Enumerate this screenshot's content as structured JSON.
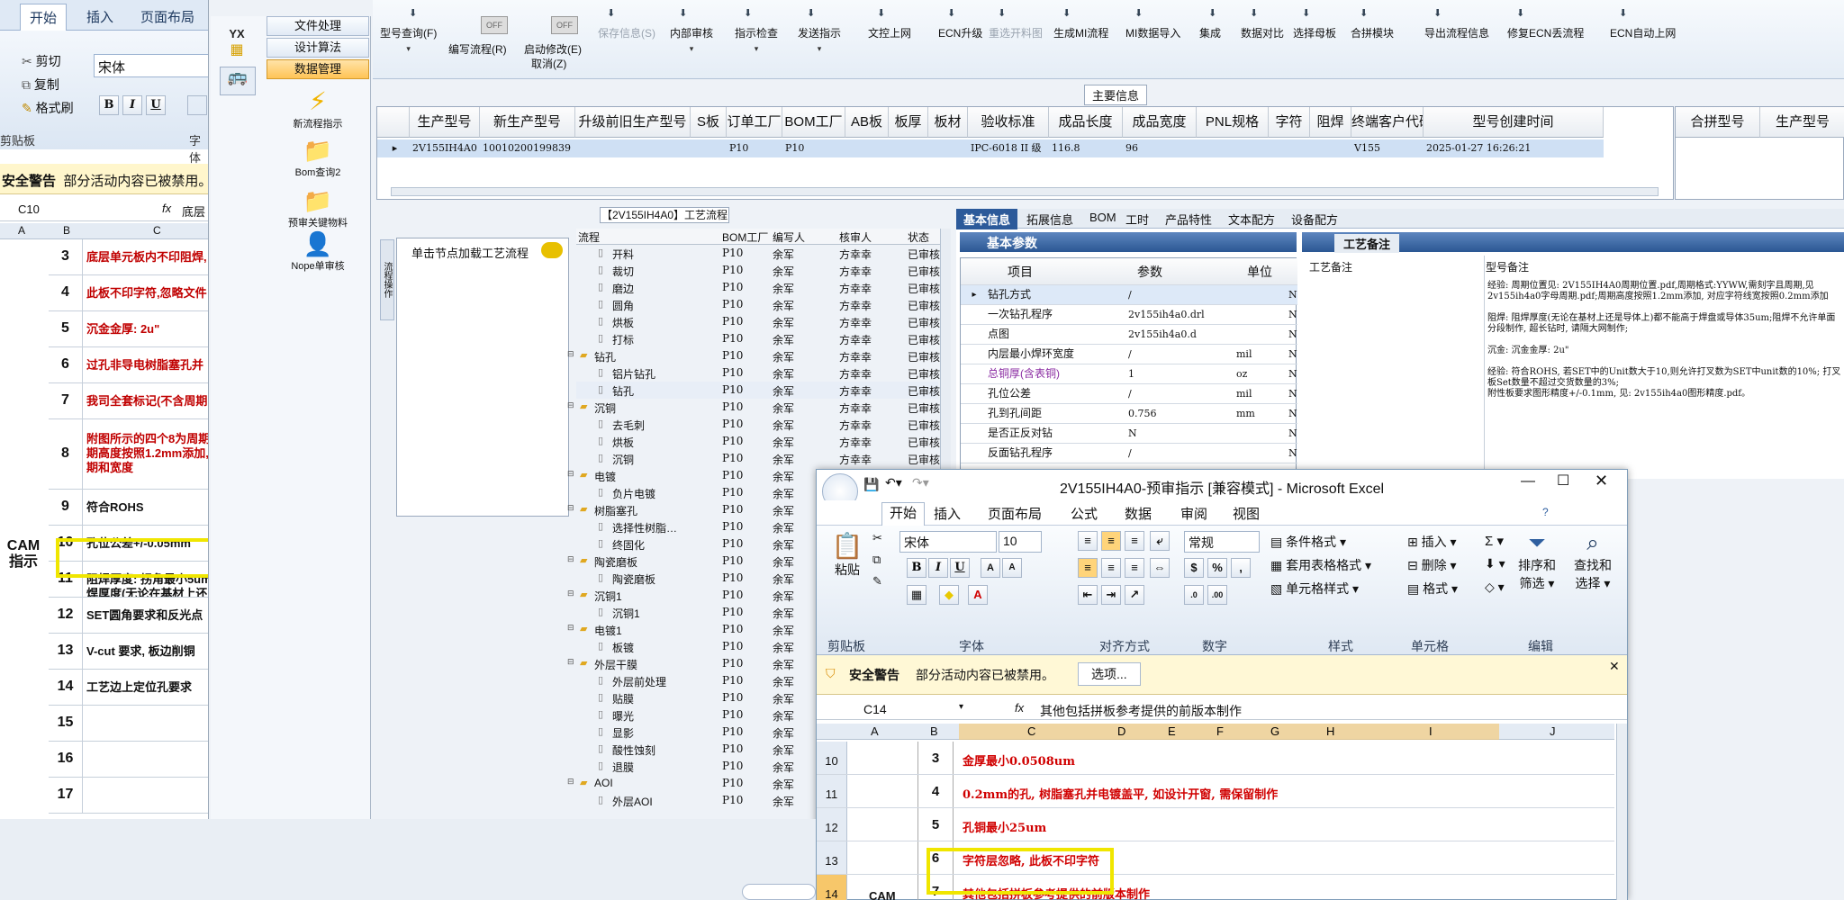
{
  "left_excel": {
    "tabs": [
      "开始",
      "插入",
      "页面布局"
    ],
    "clipboard": [
      "剪切",
      "复制",
      "格式刷"
    ],
    "font": "宋体",
    "group_clipboard": "剪贴板",
    "group_font": "字体",
    "security_warning": "安全警告",
    "security_msg": "部分活动内容已被禁用。",
    "cell_ref": "C10",
    "formula_partial": "底层",
    "col_headers": [
      "A",
      "B",
      "C"
    ],
    "side_label": "CAM 指示",
    "rows": [
      {
        "n": "3",
        "t": "底层单元板内不印阻焊,",
        "red": true
      },
      {
        "n": "4",
        "t": "此板不印字符,忽略文件",
        "red": true
      },
      {
        "n": "5",
        "t": "沉金金厚: 2u\"",
        "red": true
      },
      {
        "n": "6",
        "t": "过孔非导电树脂塞孔并",
        "red": true
      },
      {
        "n": "7",
        "t": "我司全套标记(不含周期",
        "red": true
      },
      {
        "n": "8",
        "t": "附图所示的四个8为周期\n期高度按照1.2mm添加,\n期和宽度",
        "red": true
      },
      {
        "n": "9",
        "t": "符合ROHS",
        "red": false
      },
      {
        "n": "10",
        "t": "孔位公差+/-0.05mm",
        "red": false
      },
      {
        "n": "11",
        "t": "阻焊厚度: 拐角最小5um\n焊厚度(无论在基材上还",
        "red": false
      },
      {
        "n": "12",
        "t": "SET圆角要求和反光点",
        "red": false
      },
      {
        "n": "13",
        "t": "V-cut 要求, 板边削铜",
        "red": false
      },
      {
        "n": "14",
        "t": "工艺边上定位孔要求",
        "red": false
      },
      {
        "n": "15",
        "t": "",
        "red": false
      },
      {
        "n": "16",
        "t": "",
        "red": false
      },
      {
        "n": "17",
        "t": "",
        "red": false
      }
    ]
  },
  "nav": {
    "buttons": [
      "文件处理",
      "设计算法",
      "数据管理"
    ],
    "items": [
      "新流程指示",
      "Bom查询2",
      "预审关键物料",
      "Nope单审核"
    ]
  },
  "toolbar": {
    "items": [
      "型号查询(F)",
      "编写流程(R)",
      "启动修改(E)",
      "取消(Z)",
      "保存信息(S)",
      "内部审核",
      "指示检查",
      "发送指示",
      "文控上网",
      "ECN升级",
      "重选开料图",
      "生成MI流程",
      "MI数据导入",
      "集成",
      "数据对比",
      "选择母板",
      "合拼模块",
      "导出流程信息",
      "修复ECN丢流程",
      "ECN自动上网"
    ],
    "toggle_label": "OFF"
  },
  "main_info": {
    "label": "主要信息",
    "headers": [
      "生产型号",
      "新生产型号",
      "升级前旧生产型号",
      "S板",
      "订单工厂",
      "BOM工厂",
      "AB板",
      "板厚",
      "板材",
      "验收标准",
      "成品长度",
      "成品宽度",
      "PNL规格",
      "字符",
      "阻焊",
      "终端客户代码",
      "型号创建时间"
    ],
    "row": [
      "2V155IH4A0",
      "10010200199839",
      "",
      "",
      "P10",
      "P10",
      "",
      "",
      "",
      "IPC-6018 II 级",
      "116.8",
      "96",
      "",
      "",
      "",
      "V155",
      "2025-01-27 16:26:21"
    ],
    "right_headers": [
      "合拼型号",
      "生产型号"
    ]
  },
  "process": {
    "title": "【2V155IH4A0】工艺流程",
    "left_tab": "流程操作",
    "left_box": "单击节点加载工艺流程",
    "headers": [
      "流程",
      "BOM工厂",
      "编写人",
      "核审人",
      "状态"
    ],
    "rows": [
      {
        "level": 1,
        "name": "开料",
        "f": "P10",
        "w": "余军",
        "r": "方幸幸",
        "s": "已审核"
      },
      {
        "level": 1,
        "name": "裁切",
        "f": "P10",
        "w": "余军",
        "r": "方幸幸",
        "s": "已审核"
      },
      {
        "level": 1,
        "name": "磨边",
        "f": "P10",
        "w": "余军",
        "r": "方幸幸",
        "s": "已审核"
      },
      {
        "level": 1,
        "name": "圆角",
        "f": "P10",
        "w": "余军",
        "r": "方幸幸",
        "s": "已审核"
      },
      {
        "level": 1,
        "name": "烘板",
        "f": "P10",
        "w": "余军",
        "r": "方幸幸",
        "s": "已审核"
      },
      {
        "level": 1,
        "name": "打标",
        "f": "P10",
        "w": "余军",
        "r": "方幸幸",
        "s": "已审核"
      },
      {
        "level": 0,
        "name": "钻孔",
        "f": "P10",
        "w": "余军",
        "r": "方幸幸",
        "s": "已审核"
      },
      {
        "level": 1,
        "name": "铝片钻孔",
        "f": "P10",
        "w": "余军",
        "r": "方幸幸",
        "s": "已审核"
      },
      {
        "level": 1,
        "name": "钻孔",
        "f": "P10",
        "w": "余军",
        "r": "方幸幸",
        "s": "已审核"
      },
      {
        "level": 0,
        "name": "沉铜",
        "f": "P10",
        "w": "余军",
        "r": "方幸幸",
        "s": "已审核"
      },
      {
        "level": 1,
        "name": "去毛刺",
        "f": "P10",
        "w": "余军",
        "r": "方幸幸",
        "s": "已审核"
      },
      {
        "level": 1,
        "name": "烘板",
        "f": "P10",
        "w": "余军",
        "r": "方幸幸",
        "s": "已审核"
      },
      {
        "level": 1,
        "name": "沉铜",
        "f": "P10",
        "w": "余军",
        "r": "方幸幸",
        "s": "已审核"
      },
      {
        "level": 0,
        "name": "电镀",
        "f": "P10",
        "w": "余军",
        "r": "方幸幸",
        "s": "已审核"
      },
      {
        "level": 1,
        "name": "负片电镀",
        "f": "P10",
        "w": "余军",
        "r": "方幸幸",
        "s": "已审核"
      },
      {
        "level": 0,
        "name": "树脂塞孔",
        "f": "P10",
        "w": "余军",
        "r": "方幸幸",
        "s": "已审核"
      },
      {
        "level": 1,
        "name": "选择性树脂…",
        "f": "P10",
        "w": "余军",
        "r": "方幸幸",
        "s": "已审核"
      },
      {
        "level": 1,
        "name": "终固化",
        "f": "P10",
        "w": "余军",
        "r": "方幸幸",
        "s": "已审核"
      },
      {
        "level": 0,
        "name": "陶瓷磨板",
        "f": "P10",
        "w": "余军",
        "r": "方幸幸",
        "s": "已审核"
      },
      {
        "level": 1,
        "name": "陶瓷磨板",
        "f": "P10",
        "w": "余军",
        "r": "方幸幸",
        "s": "已审核"
      },
      {
        "level": 0,
        "name": "沉铜1",
        "f": "P10",
        "w": "余军",
        "r": "方幸幸",
        "s": "已审核"
      },
      {
        "level": 1,
        "name": "沉铜1",
        "f": "P10",
        "w": "余军",
        "r": "方幸幸",
        "s": "已审核"
      },
      {
        "level": 0,
        "name": "电镀1",
        "f": "P10",
        "w": "余军",
        "r": "方幸幸",
        "s": "已审核"
      },
      {
        "level": 1,
        "name": "板镀",
        "f": "P10",
        "w": "余军",
        "r": "方幸幸",
        "s": "已审核"
      },
      {
        "level": 0,
        "name": "外层干膜",
        "f": "P10",
        "w": "余军",
        "r": "方幸幸",
        "s": "已审核"
      },
      {
        "level": 1,
        "name": "外层前处理",
        "f": "P10",
        "w": "余军",
        "r": "方幸幸",
        "s": "已审核"
      },
      {
        "level": 1,
        "name": "贴膜",
        "f": "P10",
        "w": "余军",
        "r": "方幸幸",
        "s": "已审核"
      },
      {
        "level": 1,
        "name": "曝光",
        "f": "P10",
        "w": "余军",
        "r": "方幸幸",
        "s": "已审核"
      },
      {
        "level": 1,
        "name": "显影",
        "f": "P10",
        "w": "余军",
        "r": "方幸幸",
        "s": "已审核"
      },
      {
        "level": 1,
        "name": "酸性蚀刻",
        "f": "P10",
        "w": "余军",
        "r": "方幸幸",
        "s": "已审核"
      },
      {
        "level": 1,
        "name": "退膜",
        "f": "P10",
        "w": "余军",
        "r": "方幸幸",
        "s": "已审核"
      },
      {
        "level": 0,
        "name": "AOI",
        "f": "P10",
        "w": "余军",
        "r": "方幸幸",
        "s": "已审核"
      },
      {
        "level": 1,
        "name": "外层AOI",
        "f": "P10",
        "w": "余军",
        "r": "方幸幸",
        "s": "已审核"
      }
    ]
  },
  "right_panel": {
    "tabs": [
      "基本信息",
      "拓展信息",
      "BOM",
      "工时",
      "产品特性",
      "文本配方",
      "设备配方"
    ],
    "basic_params": "基本参数",
    "param_headers": [
      "项目",
      "参数",
      "单位"
    ],
    "params": [
      {
        "item": "钻孔方式",
        "value": "/",
        "unit": ""
      },
      {
        "item": "一次钻孔程序",
        "value": "2v155ih4a0.drl",
        "unit": ""
      },
      {
        "item": "点图",
        "value": "2v155ih4a0.d",
        "unit": ""
      },
      {
        "item": "内层最小焊环宽度",
        "value": "/",
        "unit": "mil"
      },
      {
        "item": "总铜厚(含表铜)",
        "value": "1",
        "unit": "oz"
      },
      {
        "item": "孔位公差",
        "value": "/",
        "unit": "mil"
      },
      {
        "item": "孔到孔间距",
        "value": "0.756",
        "unit": "mm"
      },
      {
        "item": "是否正反对钻",
        "value": "N",
        "unit": ""
      },
      {
        "item": "反面钻孔程序",
        "value": "/",
        "unit": ""
      }
    ],
    "flag": "N",
    "process_note_tab": "工艺备注",
    "process_note_col": "工艺备注",
    "model_note_col": "型号备注",
    "model_note": "经验: 周期位置见: 2V155IH4A0周期位置.pdf,周期格式:YYWW,需刻字且周期,见2v155ih4a0字母周期.pdf;周期高度按照1.2mm添加, 对应字符线宽按照0.2mm添加\n\n阻焊: 阻焊厚度(无论在基材上还是导体上)都不能高于焊盘或导体35um;阻焊不允许单面分段制作, 超长钻时, 请隔大网制作;\n\n沉金: 沉金金厚: 2u\"\n\n经验: 符合ROHS, 若SET中的Unit数大于10,则允许打叉数为SET中unit数的10%; 打叉板Set数量不超过交货数量的3%;\n附性板要求图形精度+/-0.1mm, 见: 2v155ih4a0图形精度.pdf。"
  },
  "excel": {
    "title": "2V155IH4A0-预审指示 [兼容模式] - Microsoft Excel",
    "tabs": [
      "开始",
      "插入",
      "页面布局",
      "公式",
      "数据",
      "审阅",
      "视图"
    ],
    "font": "宋体",
    "size": "10",
    "number_format": "常规",
    "paste": "粘贴",
    "groups": [
      "剪贴板",
      "字体",
      "对齐方式",
      "数字",
      "样式",
      "单元格",
      "编辑"
    ],
    "styles": [
      "条件格式",
      "套用表格格式",
      "单元格样式"
    ],
    "cells": [
      "插入",
      "删除",
      "格式"
    ],
    "edit": [
      "排序和",
      "筛选",
      "查找和",
      "选择"
    ],
    "security_warning": "安全警告",
    "security_msg": "部分活动内容已被禁用。",
    "options": "选项...",
    "cell_ref": "C14",
    "formula": "其他包括拼板参考提供的前版本制作",
    "col_headers": [
      "A",
      "B",
      "C",
      "D",
      "E",
      "F",
      "G",
      "H",
      "I",
      "J"
    ],
    "rows": [
      {
        "rh": "10",
        "n": "3",
        "t": "金厚最小0.0508um"
      },
      {
        "rh": "11",
        "n": "4",
        "t": "0.2mm的孔, 树脂塞孔并电镀盖平, 如设计开窗, 需保留制作"
      },
      {
        "rh": "12",
        "n": "5",
        "t": "孔铜最小25um"
      },
      {
        "rh": "13",
        "n": "6",
        "t": "字符层忽略, 此板不印字符"
      },
      {
        "rh": "14",
        "n": "7",
        "t": "其他包括拼板参考提供的前版本制作"
      }
    ],
    "side_label": "CAM"
  }
}
